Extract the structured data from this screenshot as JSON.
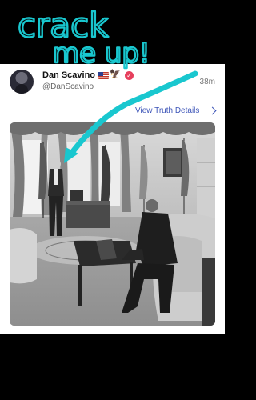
{
  "caption": {
    "line1": "crack",
    "line2": "me up!"
  },
  "post": {
    "display_name": "Dan Scavino",
    "handle": "@DanScavino",
    "time": "38m",
    "view_details": "View Truth Details",
    "icons": [
      "us-flag-icon",
      "eagle-icon",
      "verified-icon"
    ]
  },
  "colors": {
    "caption": "#19c7cf",
    "link": "#3d55b8",
    "verified": "#e63f5c"
  }
}
